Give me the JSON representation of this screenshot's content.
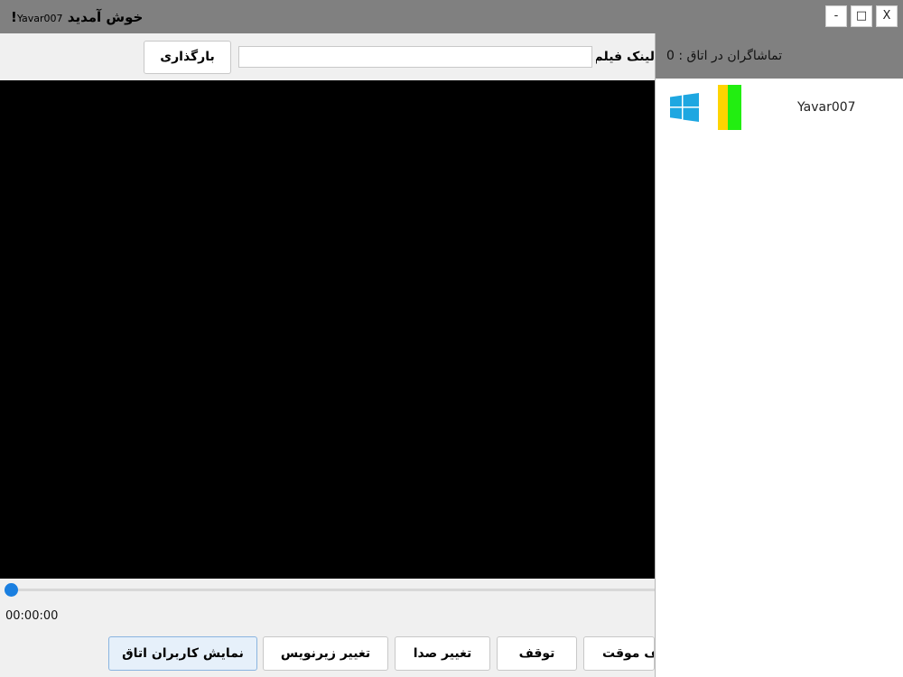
{
  "window": {
    "title_greeting": "خوش آمدید",
    "title_user": "Yavar007",
    "title_suffix": "!",
    "close_label": "X",
    "maximize_label": "□",
    "minimize_label": "-"
  },
  "toolbar": {
    "load_button": "بارگذاری",
    "url_value": "",
    "url_label": "لینک فیلم:"
  },
  "player": {
    "time": "00:00:00",
    "progress": 0
  },
  "controls": {
    "show_users": "نمایش کاربران اتاق",
    "change_subtitle": "تغییر زیرنویس",
    "change_volume": "تغییر صدا",
    "stop": "توقف",
    "pause": "توقف موقت"
  },
  "panel": {
    "viewers_text": "تماشاگران در اتاق : 0",
    "users": [
      {
        "name": "Yavar007",
        "os_icon": "windows-icon",
        "flag_colors": [
          "#ffd400",
          "#22ee11"
        ]
      }
    ]
  }
}
